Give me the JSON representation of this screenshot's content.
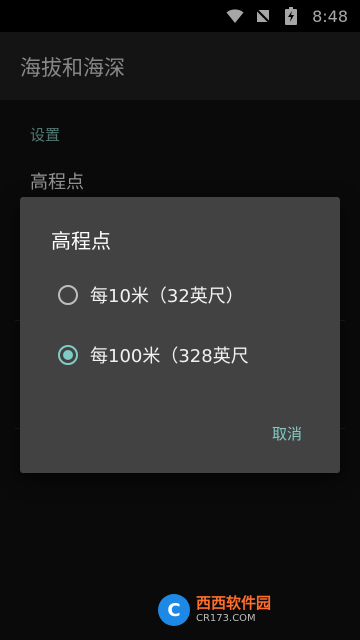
{
  "status_bar": {
    "time": "8:48",
    "icons": [
      "wifi-icon",
      "no-sim-icon",
      "battery-charging-icon"
    ]
  },
  "app_bar": {
    "title": "海拔和海深"
  },
  "settings": {
    "section_header": "设置",
    "pref_title": "高程点"
  },
  "dialog": {
    "title": "高程点",
    "options": [
      {
        "label": "每10米（32英尺）",
        "selected": false
      },
      {
        "label": "每100米（328英尺",
        "selected": true
      }
    ],
    "cancel_label": "取消"
  },
  "watermark": {
    "logo_letter": "C",
    "brand": "西西软件园",
    "domain": "CR173.COM"
  },
  "colors": {
    "accent": "#80cbc4",
    "dialog_bg": "#424242",
    "app_bar_bg": "#202020"
  }
}
